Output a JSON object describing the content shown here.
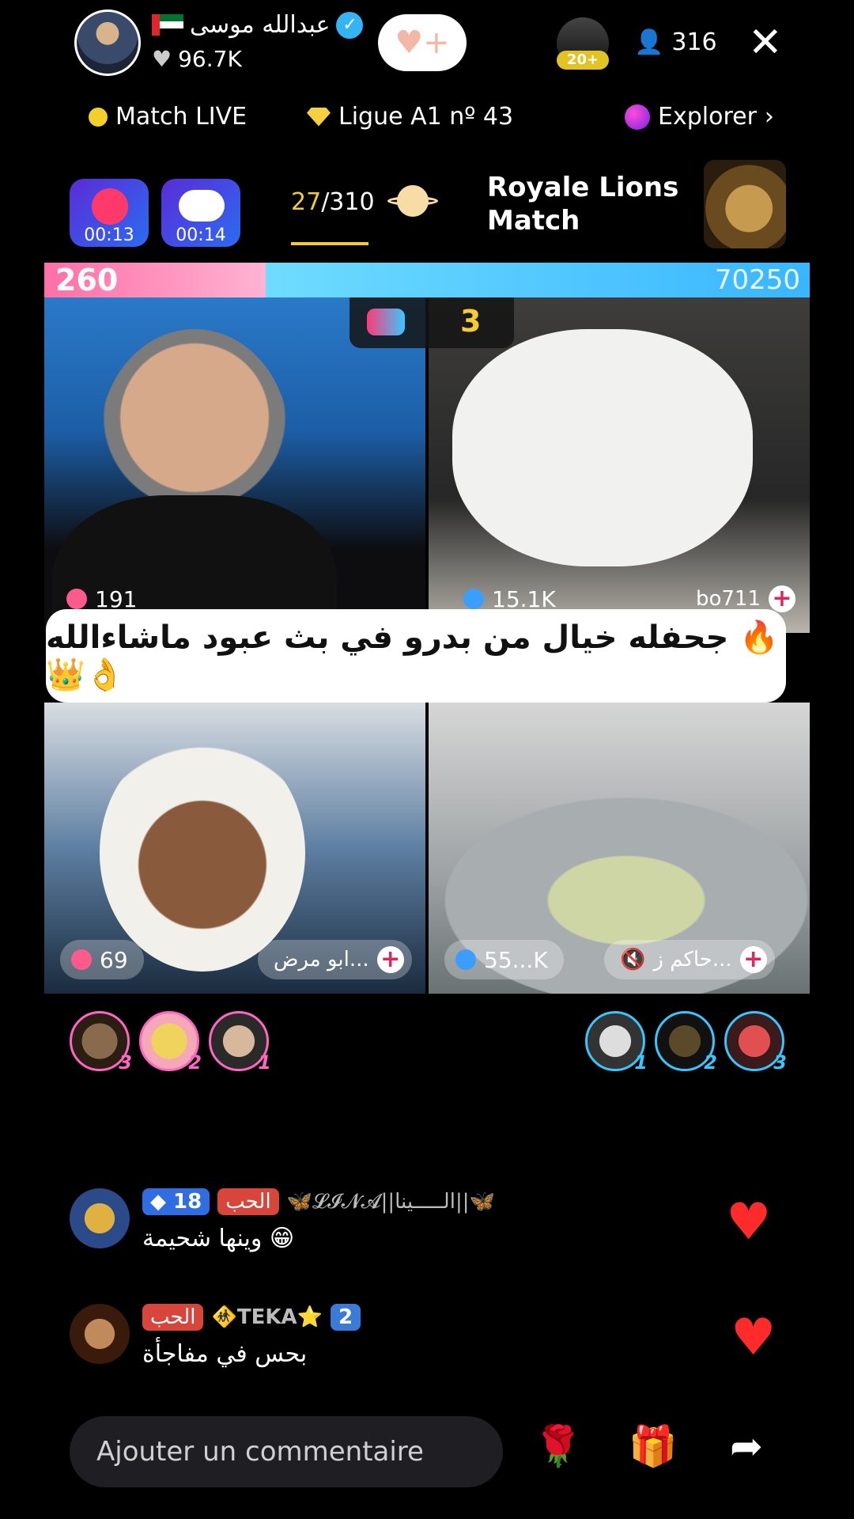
{
  "host": {
    "name": "عبدالله موسى",
    "likes": "96.7K",
    "flag_colors": [
      "#00732f",
      "#ffffff",
      "#000000"
    ]
  },
  "header": {
    "viewer_count": "316",
    "rank_badge": "20+",
    "close_glyph": "✕",
    "follow_glyph": "♥+"
  },
  "subnav": {
    "match_label": "Match LIVE",
    "league_label": "Ligue A1 nº 43",
    "explore_label": "Explorer",
    "chevron": "›"
  },
  "match": {
    "timer_1": "00:13",
    "timer_2": "00:14",
    "progress_current": "27",
    "progress_total": "/310",
    "title": "Royale Lions Match",
    "score_left": "260",
    "score_right": "70250",
    "round": "3"
  },
  "tiles": {
    "tl": {
      "stat": "191"
    },
    "tr": {
      "stat": "15.1K",
      "name": "bo711"
    },
    "bl": {
      "stat": "69",
      "name": "ابو مرض..."
    },
    "br": {
      "stat": "55...K",
      "name": "حاكم ز..."
    }
  },
  "caption": "جحفله خيال من بدرو في بث عبود ماشاءالله 🔥👑👌",
  "supporters": {
    "left_ranks": [
      "3",
      "2",
      "1"
    ],
    "right_ranks": [
      "1",
      "2",
      "3"
    ]
  },
  "comments": [
    {
      "level": "18",
      "love_badge": "الحب",
      "username": "🦋𝓛𝓘𝓝𝓐||الـــــينا||🦋",
      "text": "وينها شحيمة 😁"
    },
    {
      "level": "2",
      "love_badge": "الحب",
      "username": "🚸TEKA⭐",
      "text": "بحس في مفاجأة"
    }
  ],
  "bottom": {
    "comment_placeholder": "Ajouter un commentaire",
    "rose_icon": "🌹",
    "gift_icon": "🎁",
    "share_icon": "➦"
  },
  "colors": {
    "accent_yellow": "#f4cc32",
    "score_left": "#ff6fa7",
    "score_right": "#39b6ff"
  }
}
